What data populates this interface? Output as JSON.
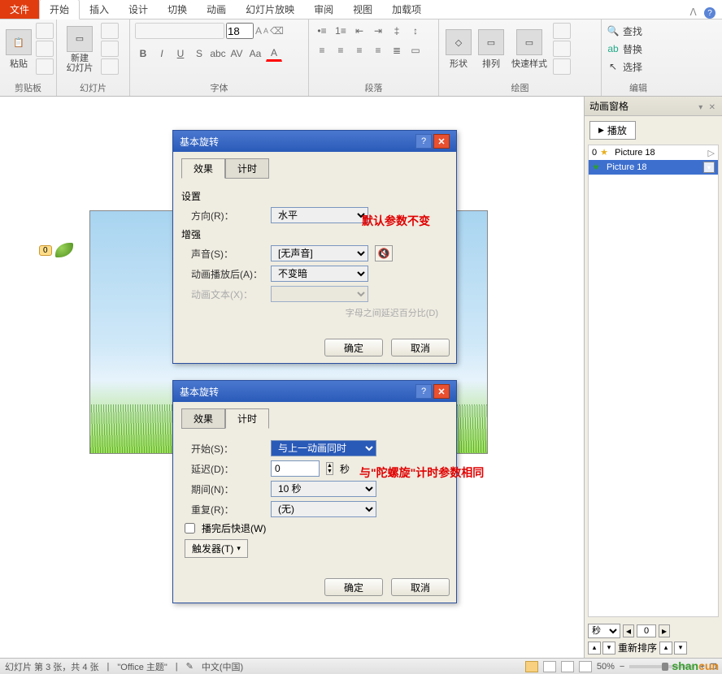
{
  "tabs": {
    "file": "文件",
    "home": "开始",
    "insert": "插入",
    "design": "设计",
    "transition": "切换",
    "animation": "动画",
    "slideshow": "幻灯片放映",
    "review": "审阅",
    "view": "视图",
    "addins": "加载项"
  },
  "ribbon": {
    "clipboard": {
      "label": "剪贴板",
      "paste": "粘贴"
    },
    "slides": {
      "label": "幻灯片",
      "newslide": "新建\n幻灯片"
    },
    "font": {
      "label": "字体",
      "size": "18"
    },
    "paragraph": {
      "label": "段落"
    },
    "drawing": {
      "label": "绘图",
      "shapes": "形状",
      "arrange": "排列",
      "quickstyle": "快速样式"
    },
    "editing": {
      "label": "编辑",
      "find": "查找",
      "replace": "替换",
      "select": "选择"
    }
  },
  "anim_pane": {
    "title": "动画窗格",
    "play": "播放",
    "items": [
      {
        "idx": "0",
        "name": "Picture 18"
      },
      {
        "idx": "",
        "name": "Picture 18"
      }
    ],
    "seconds_label": "秒",
    "seconds_value": "0",
    "reorder": "重新排序"
  },
  "dialog1": {
    "title": "基本旋转",
    "tab_effect": "效果",
    "tab_timing": "计时",
    "section_settings": "设置",
    "direction_label": "方向(R)：",
    "direction_value": "水平",
    "section_enhance": "增强",
    "sound_label": "声音(S)：",
    "sound_value": "[无声音]",
    "after_label": "动画播放后(A)：",
    "after_value": "不变暗",
    "text_label": "动画文本(X)：",
    "hint": "字母之间延迟百分比(D)",
    "ok": "确定",
    "cancel": "取消"
  },
  "dialog2": {
    "title": "基本旋转",
    "tab_effect": "效果",
    "tab_timing": "计时",
    "start_label": "开始(S)：",
    "start_value": "与上一动画同时",
    "delay_label": "延迟(D)：",
    "delay_value": "0",
    "delay_unit": "秒",
    "duration_label": "期间(N)：",
    "duration_value": "10 秒",
    "repeat_label": "重复(R)：",
    "repeat_value": "(无)",
    "rewind_label": "播完后快退(W)",
    "trigger": "触发器(T)",
    "ok": "确定",
    "cancel": "取消"
  },
  "annotations": {
    "a1": "默认参数不变",
    "a2": "与\"陀螺旋\"计时参数相同"
  },
  "leaf_tag": "0",
  "status": {
    "slide": "幻灯片 第 3 张，共 4 张",
    "theme": "\"Office 主题\"",
    "lang": "中文(中国)",
    "zoom": "50%"
  }
}
